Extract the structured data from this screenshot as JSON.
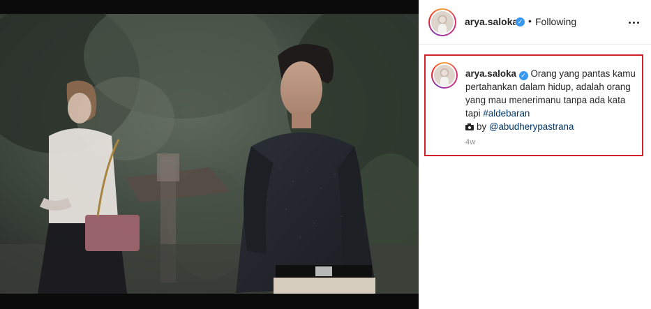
{
  "post": {
    "author": {
      "username": "arya.saloka",
      "verified_glyph": "✓",
      "follow_separator": "•",
      "follow_state": "Following"
    },
    "more_options_icon": "more-horizontal-icon",
    "caption": {
      "text": "Orang yang pantas kamu pertahankan dalam hidup, adalah orang yang mau menerimanu tanpa ada kata tapi",
      "hashtag": "#aldebaran",
      "credit_icon": "camera-icon",
      "credit_prefix": "by",
      "credit_handle": "@abudherypastrana",
      "time_ago": "4w"
    },
    "highlight_color": "#d0212b",
    "link_color": "#00376b",
    "verified_color": "#3897f0"
  }
}
